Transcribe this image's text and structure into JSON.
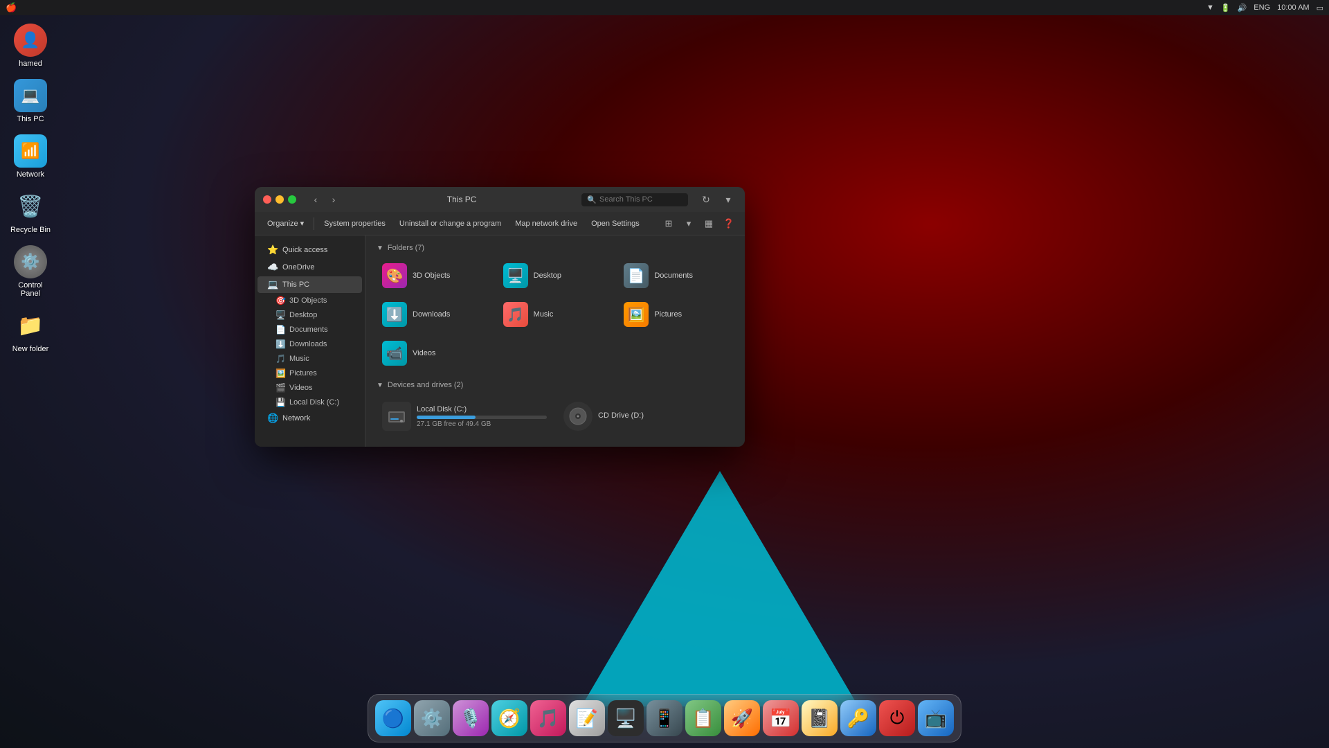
{
  "desktop": {
    "bg_color": "#1a1a2e",
    "icons": [
      {
        "id": "hamed",
        "label": "hamed",
        "icon": "👤",
        "bg": "linear-gradient(135deg,#e74c3c,#c0392b)",
        "shape": "circle"
      },
      {
        "id": "thispc",
        "label": "This PC",
        "icon": "💻",
        "bg": "linear-gradient(135deg,#3498db,#2980b9)",
        "shape": "rounded"
      },
      {
        "id": "network",
        "label": "Network",
        "icon": "📶",
        "bg": "linear-gradient(135deg,#3fc1f5,#1a9fda)",
        "shape": "rounded"
      },
      {
        "id": "recycle",
        "label": "Recycle Bin",
        "icon": "🗑️",
        "bg": "transparent",
        "shape": "none"
      },
      {
        "id": "control",
        "label": "Control Panel",
        "icon": "⚙️",
        "bg": "radial-gradient(circle,#888,#555)",
        "shape": "circle"
      },
      {
        "id": "newfolder",
        "label": "New folder",
        "icon": "📁",
        "bg": "transparent",
        "shape": "none"
      }
    ]
  },
  "topbar": {
    "apple": "🍎",
    "time": "10:00 AM",
    "lang": "ENG",
    "icons": [
      "▼",
      "🔋",
      "🔊"
    ]
  },
  "dock": {
    "items": [
      {
        "id": "finder",
        "icon": "🔵",
        "label": "Finder",
        "color": "#007aff"
      },
      {
        "id": "settings",
        "icon": "⚙️",
        "label": "System Preferences",
        "color": "#888"
      },
      {
        "id": "siri",
        "icon": "🎵",
        "label": "Siri",
        "color": "#a855f7"
      },
      {
        "id": "safari",
        "icon": "🧭",
        "label": "Safari",
        "color": "#007aff"
      },
      {
        "id": "music",
        "icon": "🎵",
        "label": "Music",
        "color": "#ff2d55"
      },
      {
        "id": "texteditor",
        "icon": "📝",
        "label": "TextEdit",
        "color": "#888"
      },
      {
        "id": "terminal",
        "icon": "🖥️",
        "label": "Terminal",
        "color": "#333"
      },
      {
        "id": "ios",
        "icon": "📱",
        "label": "iOS App Installer",
        "color": "#555"
      },
      {
        "id": "notes2",
        "icon": "📋",
        "label": "Notes App",
        "color": "#4caf50"
      },
      {
        "id": "launchpad",
        "icon": "🚀",
        "label": "Launchpad",
        "color": "#ff6b35"
      },
      {
        "id": "calendar",
        "icon": "📅",
        "label": "Calendar",
        "color": "#ff3b30"
      },
      {
        "id": "notes",
        "icon": "📓",
        "label": "Notes",
        "color": "#ffd700"
      },
      {
        "id": "onepassword",
        "icon": "🔑",
        "label": "1Password",
        "color": "#0070f3"
      },
      {
        "id": "shutdown",
        "icon": "⏻",
        "label": "Shutdown",
        "color": "#ff3b30"
      },
      {
        "id": "screenium",
        "icon": "📺",
        "label": "Screenium",
        "color": "#1c6ef3"
      }
    ]
  },
  "explorer": {
    "title": "This PC",
    "search_placeholder": "Search This PC",
    "traffic_lights": {
      "green": "#27c93f",
      "yellow": "#ffbd2e",
      "red": "#ff5f57"
    },
    "toolbar": {
      "organize": "Organize",
      "system_properties": "System properties",
      "uninstall": "Uninstall or change a program",
      "map_drive": "Map network drive",
      "open_settings": "Open Settings"
    },
    "sidebar": {
      "quick_access": "Quick access",
      "onedrive": "OneDrive",
      "this_pc": "This PC",
      "sub_items": [
        {
          "id": "3dobjects",
          "label": "3D Objects",
          "icon": "🎯"
        },
        {
          "id": "desktop",
          "label": "Desktop",
          "icon": "🖥️"
        },
        {
          "id": "documents",
          "label": "Documents",
          "icon": "📄"
        },
        {
          "id": "downloads",
          "label": "Downloads",
          "icon": "⬇️"
        },
        {
          "id": "music",
          "label": "Music",
          "icon": "🎵"
        },
        {
          "id": "pictures",
          "label": "Pictures",
          "icon": "🖼️"
        },
        {
          "id": "videos",
          "label": "Videos",
          "icon": "🎬"
        },
        {
          "id": "localdisk",
          "label": "Local Disk (C:)",
          "icon": "💾"
        }
      ],
      "network": "Network"
    },
    "folders_section": {
      "label": "Folders (7)",
      "items": [
        {
          "id": "3dobjects",
          "label": "3D Objects",
          "icon": "🎨"
        },
        {
          "id": "desktop",
          "label": "Desktop",
          "icon": "🖥️"
        },
        {
          "id": "documents",
          "label": "Documents",
          "icon": "📄"
        },
        {
          "id": "downloads",
          "label": "Downloads",
          "icon": "⬇️"
        },
        {
          "id": "music",
          "label": "Music",
          "icon": "🎵"
        },
        {
          "id": "pictures",
          "label": "Pictures",
          "icon": "🖼️"
        },
        {
          "id": "videos",
          "label": "Videos",
          "icon": "📹"
        }
      ]
    },
    "drives_section": {
      "label": "Devices and drives (2)",
      "drives": [
        {
          "id": "localc",
          "label": "Local Disk (C:)",
          "icon": "💿",
          "free": "27.1 GB free of 49.4 GB",
          "fill_pct": 45,
          "bar_color": "#3b9ddd"
        },
        {
          "id": "cdd",
          "label": "CD Drive (D:)",
          "icon": "💿",
          "free": "",
          "fill_pct": 0,
          "bar_color": "#888"
        }
      ]
    }
  }
}
